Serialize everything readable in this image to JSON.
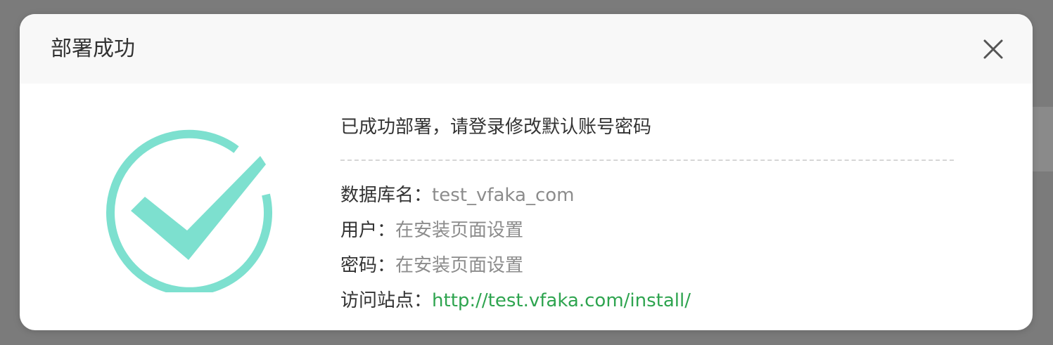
{
  "modal": {
    "title": "部署成功",
    "close_icon": "close-icon",
    "success_icon": "checkmark-circle-icon",
    "accent_color": "#7de0cf",
    "headline": "已成功部署，请登录修改默认账号密码",
    "rows": [
      {
        "label": "数据库名：",
        "value": "test_vfaka_com"
      },
      {
        "label": "用户：",
        "value": "在安装页面设置"
      },
      {
        "label": "密码：",
        "value": "在安装页面设置"
      },
      {
        "label": "访问站点：",
        "value": "http://test.vfaka.com/install/"
      }
    ]
  }
}
